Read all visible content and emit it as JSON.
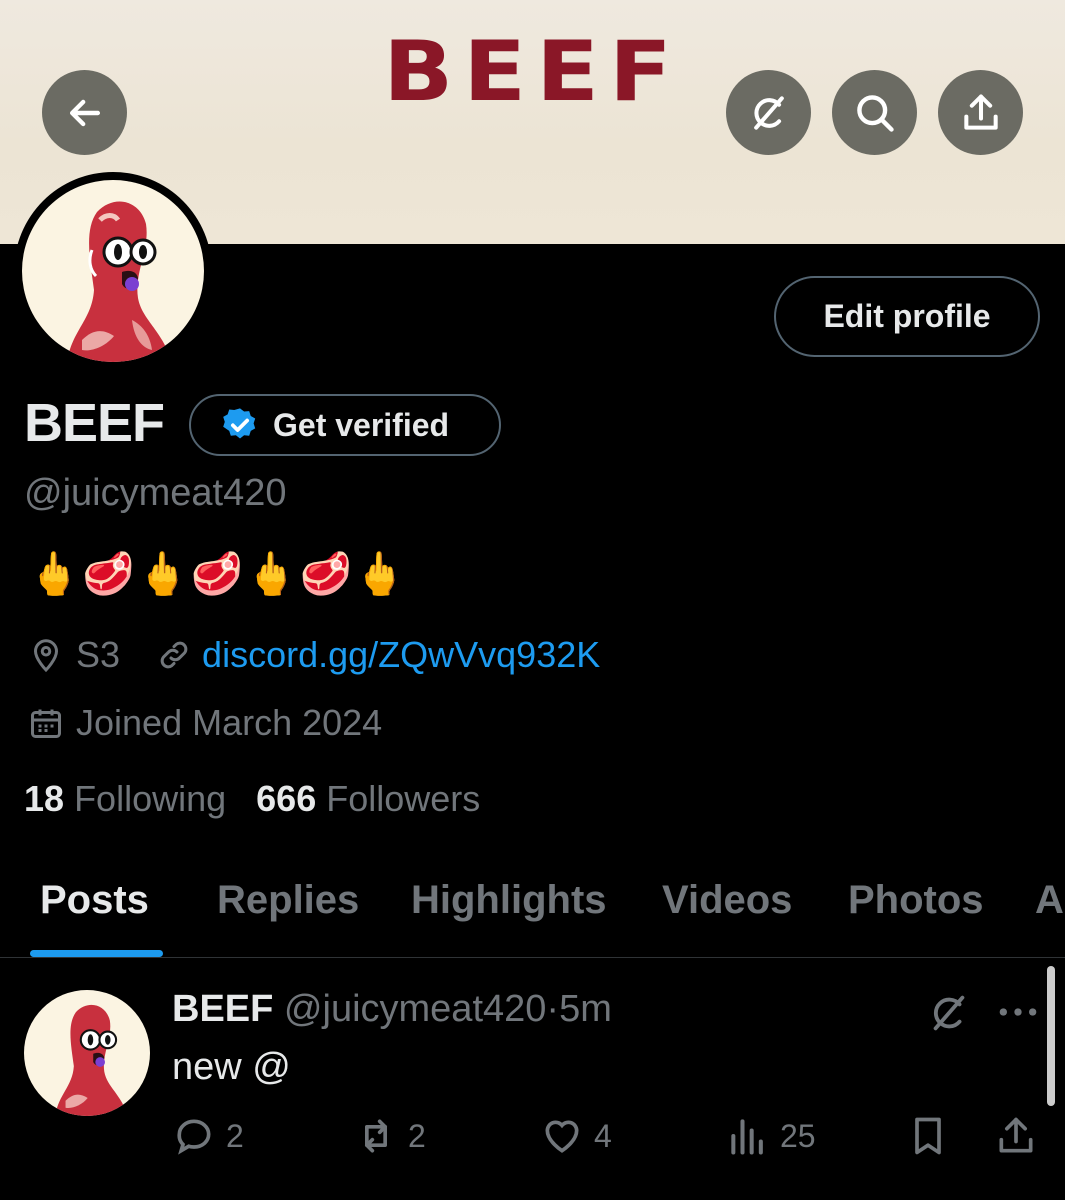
{
  "banner": {
    "logo_text": "BEEF"
  },
  "header": {
    "back_icon": "arrow-left-icon",
    "grok_icon": "grok-icon",
    "search_icon": "search-icon",
    "share_icon": "share-icon"
  },
  "profile": {
    "name": "BEEF",
    "verify_label": "Get verified",
    "handle": "@juicymeat420",
    "bio": "🖕🥩🖕🥩🖕🥩🖕",
    "location": "S3",
    "link": "discord.gg/ZQwVvq932K",
    "joined": "Joined March 2024",
    "following_count": "18",
    "following_label": "Following",
    "followers_count": "666",
    "followers_label": "Followers",
    "edit_label": "Edit profile"
  },
  "tabs": [
    {
      "label": "Posts",
      "active": true
    },
    {
      "label": "Replies",
      "active": false
    },
    {
      "label": "Highlights",
      "active": false
    },
    {
      "label": "Videos",
      "active": false
    },
    {
      "label": "Photos",
      "active": false
    },
    {
      "label": "A",
      "active": false
    }
  ],
  "post": {
    "author": "BEEF",
    "handle": "@juicymeat420",
    "separator": "·",
    "time": "5m",
    "text": "new @",
    "replies": "2",
    "reposts": "2",
    "likes": "4",
    "views": "25"
  },
  "colors": {
    "accent": "#1d9bf0",
    "brand": "#8a1727",
    "muted": "#71767b"
  }
}
